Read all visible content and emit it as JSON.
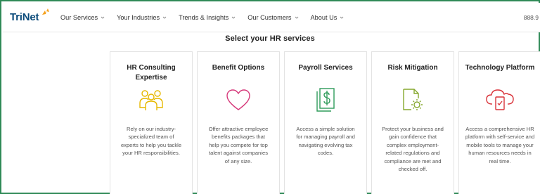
{
  "header": {
    "logo_text": "TriNet",
    "nav": [
      {
        "label": "Our Services"
      },
      {
        "label": "Your Industries"
      },
      {
        "label": "Trends & Insights"
      },
      {
        "label": "Our Customers"
      },
      {
        "label": "About Us"
      }
    ],
    "phone": "888.9"
  },
  "main": {
    "heading": "Select your HR services",
    "cards": [
      {
        "title": "HR Consulting Expertise",
        "icon": "team-icon",
        "description": "Rely on our industry-specialized team of experts to help you tackle your HR responsibilities."
      },
      {
        "title": "Benefit Options",
        "icon": "heart-icon",
        "description": "Offer attractive employee benefits packages that help you compete for top talent against companies of any size."
      },
      {
        "title": "Payroll Services",
        "icon": "payroll-dollar-icon",
        "description": "Access a simple solution for managing payroll and navigating evolving tax codes."
      },
      {
        "title": "Risk Mitigation",
        "icon": "document-gear-icon",
        "description": "Protect your business and gain confidence that complex employment-related regulations and compliance are met and checked off."
      },
      {
        "title": "Technology Platform",
        "icon": "cloud-device-icon",
        "description": "Access a comprehensive HR platform with self-service and mobile tools to manage your human resources needs in real time."
      }
    ]
  },
  "colors": {
    "frame_border": "#2f8a57",
    "logo_blue": "#0a4a7a",
    "logo_orange": "#f5a01a",
    "icon_yellow": "#e6b800",
    "icon_pink": "#d6397a",
    "icon_green": "#2e9b5a",
    "icon_olive": "#86a82e",
    "icon_red": "#d9333a"
  }
}
